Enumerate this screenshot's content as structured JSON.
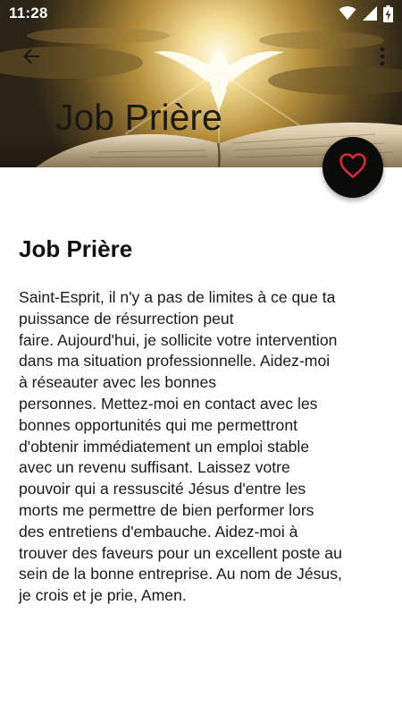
{
  "status_bar": {
    "time": "11:28",
    "icons": [
      "wifi-icon",
      "signal-icon",
      "battery-charging-icon"
    ]
  },
  "toolbar": {
    "back_icon": "arrow-back-icon",
    "menu_icon": "more-vertical-icon"
  },
  "header": {
    "title": "Job Prière"
  },
  "fab": {
    "icon": "heart-outline-icon",
    "icon_color": "#e0283a"
  },
  "article": {
    "title": "Job Prière",
    "lines": [
      "Saint-Esprit, il n'y a pas de limites à ce que ta",
      "puissance de résurrection peut",
      "faire. Aujourd'hui, je sollicite votre intervention",
      "dans ma situation professionnelle. Aidez-moi",
      "à réseauter avec les bonnes",
      "personnes. Mettez-moi en contact avec les",
      "bonnes opportunités qui me permettront",
      "d'obtenir immédiatement un emploi stable",
      "avec un revenu suffisant. Laissez votre",
      "pouvoir qui a ressuscité Jésus d'entre les",
      "morts me permettre de bien performer lors",
      "des entretiens d'embauche. Aidez-moi à",
      "trouver des faveurs pour un excellent poste au",
      "sein de la bonne entreprise. Au nom de Jésus,",
      "je crois et je prie, Amen."
    ]
  }
}
